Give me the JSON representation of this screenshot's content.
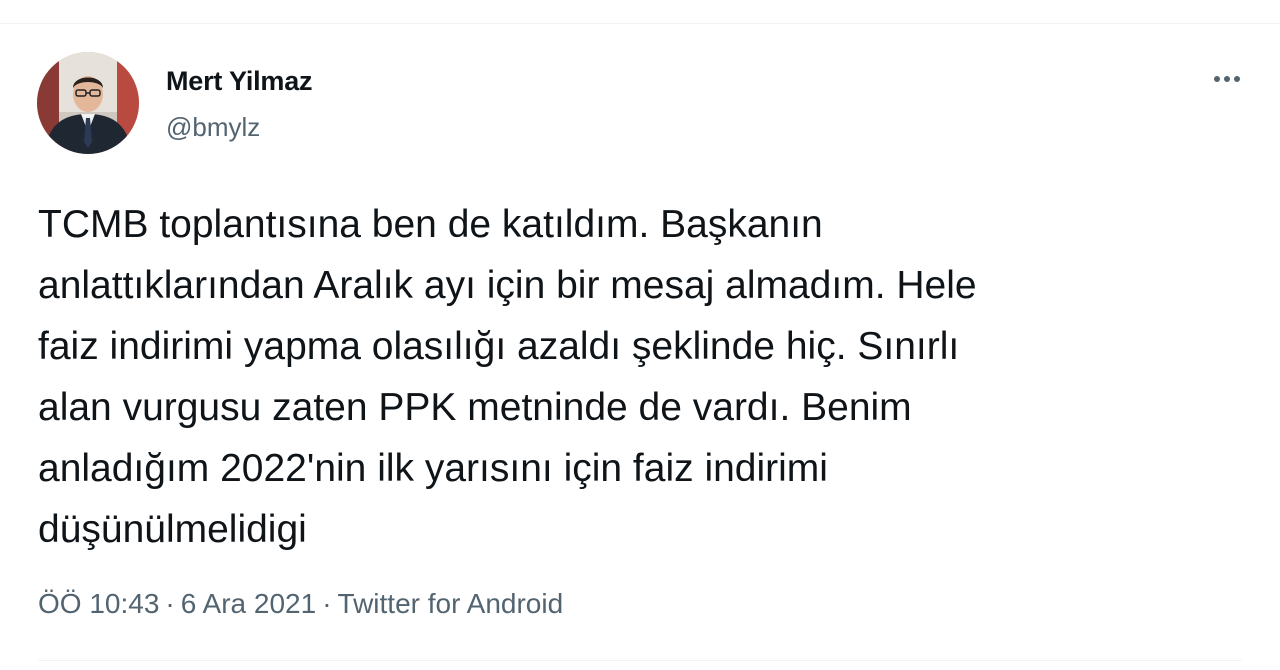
{
  "author": {
    "display_name": "Mert Yilmaz",
    "handle": "@bmylz"
  },
  "tweet": {
    "text": "TCMB toplantısına ben de katıldım. Başkanın\nanlattıklarından Aralık ayı için bir mesaj almadım. Hele\nfaiz indirimi yapma olasılığı azaldı şeklinde hiç. Sınırlı\nalan vurgusu zaten PPK metninde de vardı. Benim\nanladığım 2022'nin ilk yarısını için faiz indirimi\ndüşünülmelidigi",
    "time": "ÖÖ 10:43",
    "date": "6 Ara 2021",
    "source": "Twitter for Android",
    "separator": "·"
  },
  "icons": {
    "more": "more-horizontal-icon"
  },
  "colors": {
    "text_primary": "#0f1419",
    "text_secondary": "#536471",
    "divider": "#eff3f4"
  }
}
